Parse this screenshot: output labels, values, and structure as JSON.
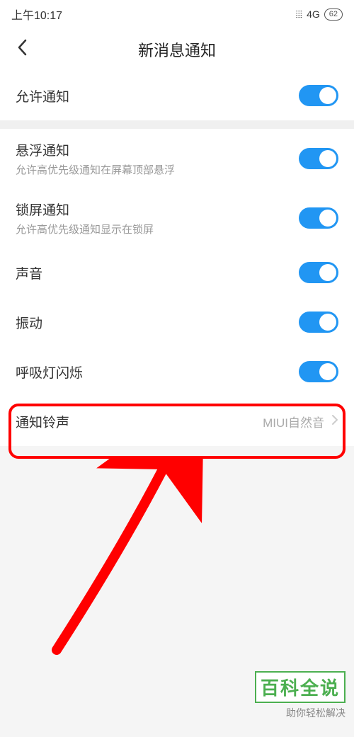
{
  "status": {
    "time": "上午10:17",
    "network": "4G",
    "battery": "62"
  },
  "header": {
    "title": "新消息通知"
  },
  "rows": {
    "allow": {
      "title": "允许通知"
    },
    "floating": {
      "title": "悬浮通知",
      "subtitle": "允许高优先级通知在屏幕顶部悬浮"
    },
    "lockscreen": {
      "title": "锁屏通知",
      "subtitle": "允许高优先级通知显示在锁屏"
    },
    "sound": {
      "title": "声音"
    },
    "vibrate": {
      "title": "振动"
    },
    "led": {
      "title": "呼吸灯闪烁"
    },
    "ringtone": {
      "title": "通知铃声",
      "value": "MIUI自然音"
    }
  },
  "watermark": {
    "title": "百科全说",
    "subtitle": "助你轻松解决"
  },
  "annotation": {
    "highlight_color": "#ff0000"
  }
}
